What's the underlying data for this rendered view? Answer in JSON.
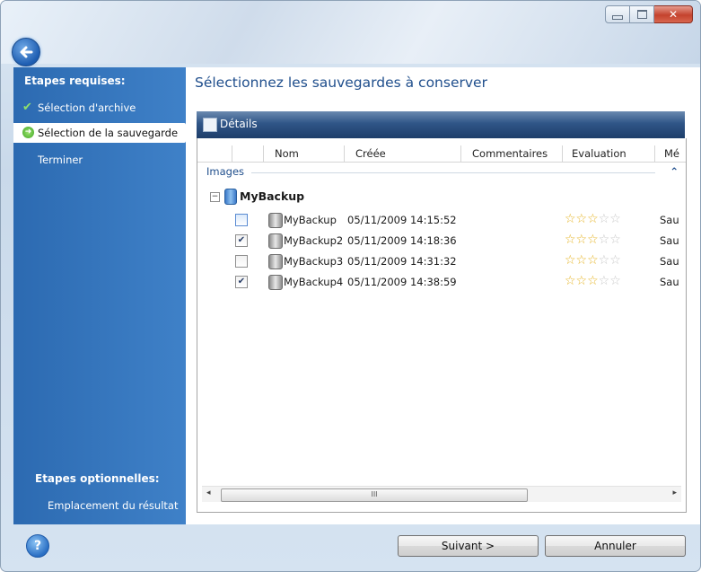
{
  "window": {
    "caption_buttons": [
      {
        "name": "minimize",
        "glyph": "▭"
      },
      {
        "name": "maximize",
        "glyph": "□"
      },
      {
        "name": "close",
        "glyph": "✕"
      }
    ]
  },
  "sidebar": {
    "required_title": "Etapes requises:",
    "required_steps": [
      {
        "label": "Sélection d'archive",
        "state": "done",
        "icon": "check-icon"
      },
      {
        "label": "Sélection de la sauvegarde",
        "state": "current",
        "icon": "arrow-right-icon"
      },
      {
        "label": "Terminer",
        "state": "pending"
      }
    ],
    "optional_title": "Etapes optionnelles:",
    "optional_steps": [
      {
        "label": "Emplacement du résultat"
      }
    ]
  },
  "main": {
    "heading": "Sélectionnez les sauvegardes à conserver",
    "details_label": "Détails",
    "columns": [
      "Nom",
      "Créée",
      "Commentaires",
      "Evaluation",
      "Mé"
    ],
    "group_label": "Images",
    "archive_name": "MyBackup",
    "rows": [
      {
        "name": "MyBackup",
        "created": "05/11/2009 14:15:52",
        "checked": false,
        "rating": 3,
        "extra": "Sau"
      },
      {
        "name": "MyBackup2",
        "created": "05/11/2009 14:18:36",
        "checked": true,
        "rating": 3,
        "extra": "Sau"
      },
      {
        "name": "MyBackup3",
        "created": "05/11/2009 14:31:32",
        "checked": false,
        "rating": 3,
        "extra": "Sau"
      },
      {
        "name": "MyBackup4",
        "created": "05/11/2009 14:38:59",
        "checked": true,
        "rating": 3,
        "extra": "Sau"
      }
    ],
    "scroll_thumb_glyph": "III"
  },
  "footer": {
    "help_glyph": "?",
    "next_label": "Suivant >",
    "cancel_label": "Annuler"
  },
  "colors": {
    "sidebar": "#3d7cc2",
    "heading": "#1f4e8c",
    "star_on": "#e5b322",
    "star_off": "#c7c7c7"
  }
}
